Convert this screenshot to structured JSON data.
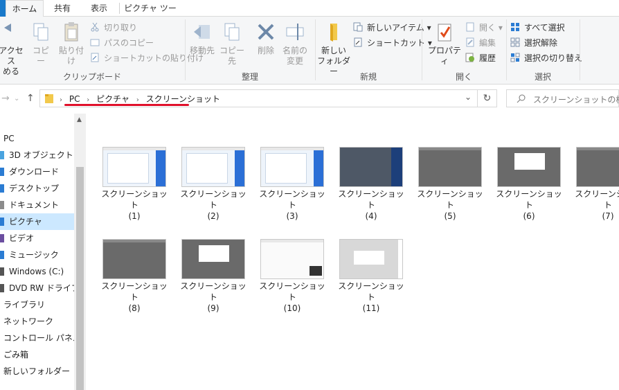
{
  "tabs": {
    "home": "ホーム",
    "share": "共有",
    "view": "表示",
    "picture_tools": "ピクチャ ツール"
  },
  "ribbon": {
    "clipboard": {
      "pin_label_1": "アクセス",
      "pin_label_2": "める",
      "copy": "コピー",
      "paste": "貼り付け",
      "cut": "切り取り",
      "copy_path": "パスのコピー",
      "paste_shortcut": "ショートカットの貼り付け",
      "group": "クリップボード"
    },
    "organize": {
      "move_to": "移動先",
      "copy_to": "コピー先",
      "delete": "削除",
      "rename_1": "名前の",
      "rename_2": "変更",
      "group": "整理"
    },
    "new": {
      "new_folder_1": "新しい",
      "new_folder_2": "フォルダー",
      "new_item": "新しいアイテム",
      "shortcut": "ショートカット",
      "group": "新規"
    },
    "open": {
      "properties": "プロパティ",
      "open": "開く",
      "edit": "編集",
      "history": "履歴",
      "group": "開く"
    },
    "select": {
      "select_all": "すべて選択",
      "select_none": "選択解除",
      "invert": "選択の切り替え",
      "group": "選択"
    }
  },
  "address": {
    "crumbs": [
      "PC",
      "ピクチャ",
      "スクリーンショット"
    ],
    "search_placeholder": "スクリーンショットの検索"
  },
  "nav": [
    {
      "label": "PC",
      "icon": "none"
    },
    {
      "label": "3D オブジェクト",
      "icon": "cube-icon"
    },
    {
      "label": "ダウンロード",
      "icon": "download-icon"
    },
    {
      "label": "デスクトップ",
      "icon": "desktop-icon"
    },
    {
      "label": "ドキュメント",
      "icon": "document-icon"
    },
    {
      "label": "ピクチャ",
      "icon": "picture-icon",
      "selected": true
    },
    {
      "label": "ビデオ",
      "icon": "video-icon"
    },
    {
      "label": "ミュージック",
      "icon": "music-icon"
    },
    {
      "label": "Windows (C:)",
      "icon": "drive-icon"
    },
    {
      "label": "DVD RW ドライブ (D",
      "icon": "dvd-icon"
    },
    {
      "label": "ライブラリ",
      "icon": "none"
    },
    {
      "label": "ネットワーク",
      "icon": "none"
    },
    {
      "label": "コントロール パネル",
      "icon": "none"
    },
    {
      "label": "ごみ箱",
      "icon": "none"
    },
    {
      "label": "新しいフォルダー",
      "icon": "none"
    }
  ],
  "files": [
    {
      "name": "スクリーンショット",
      "num": "(1)"
    },
    {
      "name": "スクリーンショット",
      "num": "(2)"
    },
    {
      "name": "スクリーンショット",
      "num": "(3)"
    },
    {
      "name": "スクリーンショット",
      "num": "(4)"
    },
    {
      "name": "スクリーンショット",
      "num": "(5)"
    },
    {
      "name": "スクリーンショット",
      "num": "(6)"
    },
    {
      "name": "スクリーンショット",
      "num": "(7)"
    },
    {
      "name": "スクリーンショット",
      "num": "(8)"
    },
    {
      "name": "スクリーンショット",
      "num": "(9)"
    },
    {
      "name": "スクリーンショット",
      "num": "(10)"
    },
    {
      "name": "スクリーンショット",
      "num": "(11)"
    }
  ],
  "colors": {
    "accent": "#1979ca",
    "selection": "#cce8ff",
    "underline": "#e0102a"
  }
}
